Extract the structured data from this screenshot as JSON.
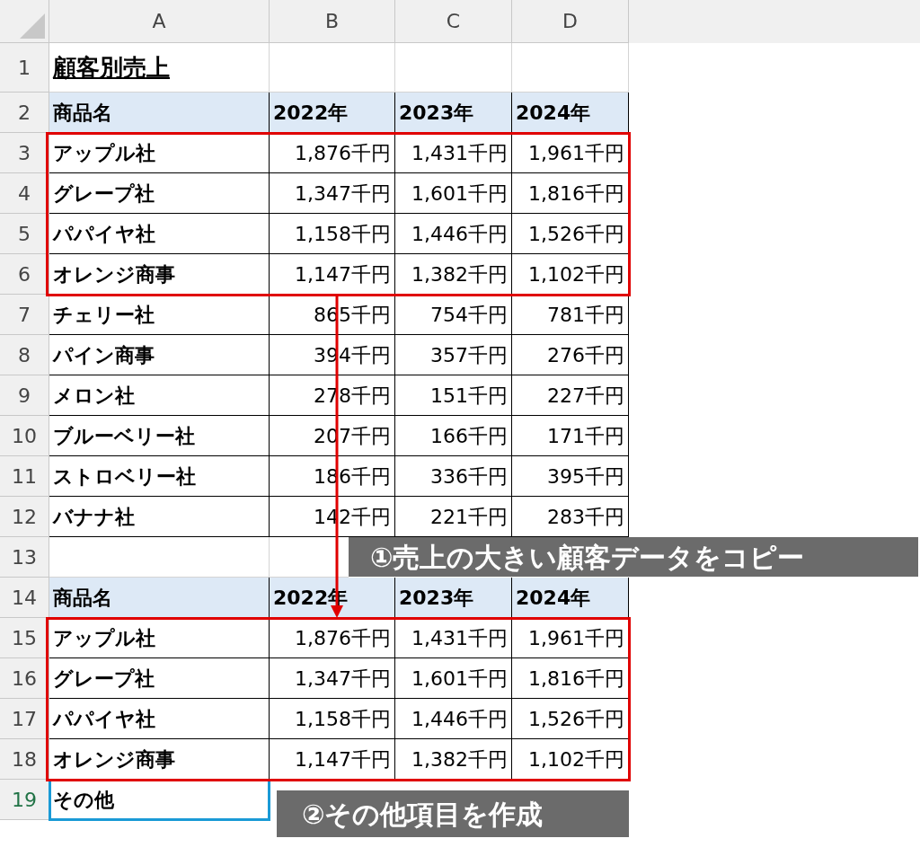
{
  "column_headers": [
    "A",
    "B",
    "C",
    "D"
  ],
  "rows": [
    {
      "number": "1",
      "kind": "title",
      "selected": false,
      "cells": [
        "顧客別売上"
      ]
    },
    {
      "number": "2",
      "kind": "header",
      "selected": false,
      "cells": [
        "商品名",
        "2022年",
        "2023年",
        "2024年"
      ]
    },
    {
      "number": "3",
      "kind": "data",
      "selected": false,
      "cells": [
        "アップル社",
        "1,876千円",
        "1,431千円",
        "1,961千円"
      ]
    },
    {
      "number": "4",
      "kind": "data",
      "selected": false,
      "cells": [
        "グレープ社",
        "1,347千円",
        "1,601千円",
        "1,816千円"
      ]
    },
    {
      "number": "5",
      "kind": "data",
      "selected": false,
      "cells": [
        "パパイヤ社",
        "1,158千円",
        "1,446千円",
        "1,526千円"
      ]
    },
    {
      "number": "6",
      "kind": "data",
      "selected": false,
      "cells": [
        "オレンジ商事",
        "1,147千円",
        "1,382千円",
        "1,102千円"
      ]
    },
    {
      "number": "7",
      "kind": "data",
      "selected": false,
      "cells": [
        "チェリー社",
        "865千円",
        "754千円",
        "781千円"
      ]
    },
    {
      "number": "8",
      "kind": "data",
      "selected": false,
      "cells": [
        "パイン商事",
        "394千円",
        "357千円",
        "276千円"
      ]
    },
    {
      "number": "9",
      "kind": "data",
      "selected": false,
      "cells": [
        "メロン社",
        "278千円",
        "151千円",
        "227千円"
      ]
    },
    {
      "number": "10",
      "kind": "data",
      "selected": false,
      "cells": [
        "ブルーベリー社",
        "207千円",
        "166千円",
        "171千円"
      ]
    },
    {
      "number": "11",
      "kind": "data",
      "selected": false,
      "cells": [
        "ストロベリー社",
        "186千円",
        "336千円",
        "395千円"
      ]
    },
    {
      "number": "12",
      "kind": "data",
      "selected": false,
      "cells": [
        "バナナ社",
        "142千円",
        "221千円",
        "283千円"
      ]
    },
    {
      "number": "13",
      "kind": "blank",
      "selected": false,
      "cells": [],
      "callout": "①売上の大きい顧客データをコピー"
    },
    {
      "number": "14",
      "kind": "header",
      "selected": false,
      "cells": [
        "商品名",
        "2022年",
        "2023年",
        "2024年"
      ]
    },
    {
      "number": "15",
      "kind": "data",
      "selected": false,
      "cells": [
        "アップル社",
        "1,876千円",
        "1,431千円",
        "1,961千円"
      ]
    },
    {
      "number": "16",
      "kind": "data",
      "selected": false,
      "cells": [
        "グレープ社",
        "1,347千円",
        "1,601千円",
        "1,816千円"
      ]
    },
    {
      "number": "17",
      "kind": "data",
      "selected": false,
      "cells": [
        "パパイヤ社",
        "1,158千円",
        "1,446千円",
        "1,526千円"
      ]
    },
    {
      "number": "18",
      "kind": "data",
      "selected": false,
      "cells": [
        "オレンジ商事",
        "1,147千円",
        "1,382千円",
        "1,102千円"
      ]
    },
    {
      "number": "19",
      "kind": "label",
      "selected": true,
      "cells": [
        "その他"
      ],
      "callout": "②その他項目を作成"
    }
  ]
}
